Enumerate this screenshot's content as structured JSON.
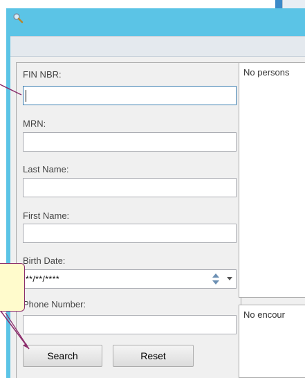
{
  "fields": {
    "fin_label": "FIN NBR:",
    "mrn_label": "MRN:",
    "last_name_label": "Last Name:",
    "first_name_label": "First Name:",
    "birth_date_label": "Birth Date:",
    "birth_date_value": "**/**/****",
    "phone_label": "Phone Number:"
  },
  "buttons": {
    "search": "Search",
    "reset": "Reset"
  },
  "persons_pane": {
    "empty_text": "No persons"
  },
  "encounters_pane": {
    "empty_text": "No encour"
  },
  "icons": {
    "title": "magnifier-icon",
    "spin_up": "arrow-up-icon",
    "spin_down": "arrow-down-icon",
    "dropdown": "chevron-down-icon"
  },
  "colors": {
    "window_frame": "#5bc4e6",
    "callout_border": "#8b2c6b",
    "callout_fill": "#fffbcc"
  }
}
